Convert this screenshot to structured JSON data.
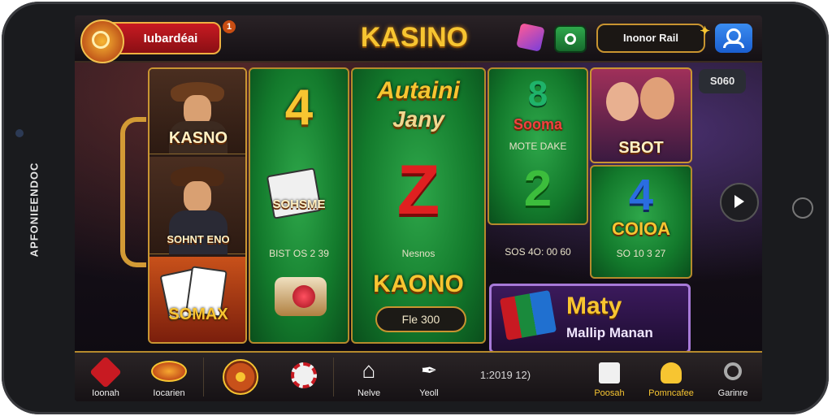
{
  "device": {
    "side_text": "APFONIEENDOC"
  },
  "header": {
    "user_label": "Iubardéai",
    "notif_count": "1",
    "app_title": "KASINO",
    "member_label": "Inonor Rail"
  },
  "side": {
    "top_right_badge": "S060"
  },
  "grid": {
    "col1": {
      "tile1_label": "KASNO",
      "tile2_label": "SOHNT ENO",
      "tile3_label": "SOMAX"
    },
    "col2": {
      "number_top": "4",
      "tile_label": "SOHSME",
      "caption": "BIST OS 2 39"
    },
    "col3": {
      "headline1": "Autaini",
      "headline2": "Jany",
      "big_letter": "Z",
      "caption": "Nesnos",
      "label": "KAONO",
      "button": "Fle 300"
    },
    "col4": {
      "sign_number": "8",
      "sign_word": "Sooma",
      "caption_top": "MOTE DAKE",
      "number": "2",
      "caption": "SOS 4O: 00 60"
    },
    "col5": {
      "tile_label": "SBOT",
      "number": "4",
      "tile_label2": "COIOA",
      "caption": "SO 10 3 27"
    },
    "banner": {
      "line1": "Maty",
      "line2": "Mallip Manan"
    }
  },
  "bottom_nav": {
    "items": [
      {
        "label": "Ioonah"
      },
      {
        "label": "Iocarien"
      },
      {
        "label": ""
      },
      {
        "label": ""
      },
      {
        "label": "Nelve"
      },
      {
        "label": "Yeoll"
      },
      {
        "label": "1:2019 12)"
      },
      {
        "label": "Poosah"
      },
      {
        "label": "Pomncafee"
      },
      {
        "label": "Garinre"
      }
    ]
  },
  "colors": {
    "accent_gold": "#f7c531",
    "brand_red": "#c81a22",
    "felt_green": "#137a2c"
  }
}
